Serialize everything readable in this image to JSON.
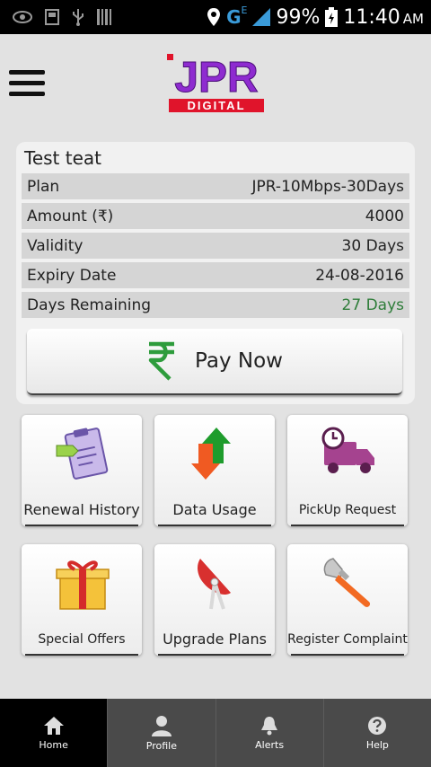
{
  "status_bar": {
    "network": "G",
    "network_sub": "E",
    "battery": "99%",
    "time": "11:40",
    "ampm": "AM"
  },
  "header": {
    "logo_main": "JPR",
    "logo_sub": "DIGITAL"
  },
  "customer": {
    "name": "Test teat",
    "rows": [
      {
        "label": "Plan",
        "value": "JPR-10Mbps-30Days"
      },
      {
        "label": "Amount (₹)",
        "value": "4000"
      },
      {
        "label": "Validity",
        "value": "30 Days"
      },
      {
        "label": "Expiry Date",
        "value": "24-08-2016"
      },
      {
        "label": "Days Remaining",
        "value": "27 Days"
      }
    ],
    "pay_label": "Pay Now"
  },
  "tiles": [
    {
      "label": "Renewal History"
    },
    {
      "label": "Data Usage"
    },
    {
      "label": "PickUp Request"
    },
    {
      "label": "Special Offers"
    },
    {
      "label": "Upgrade Plans"
    },
    {
      "label": "Register Complaint"
    }
  ],
  "nav": [
    {
      "label": "Home"
    },
    {
      "label": "Profile"
    },
    {
      "label": "Alerts"
    },
    {
      "label": "Help"
    }
  ],
  "colors": {
    "brand_purple": "#8e2bd0",
    "brand_red": "#e0142b",
    "green_value": "#2f7d3a",
    "nav_bg": "#4a4a4a"
  }
}
